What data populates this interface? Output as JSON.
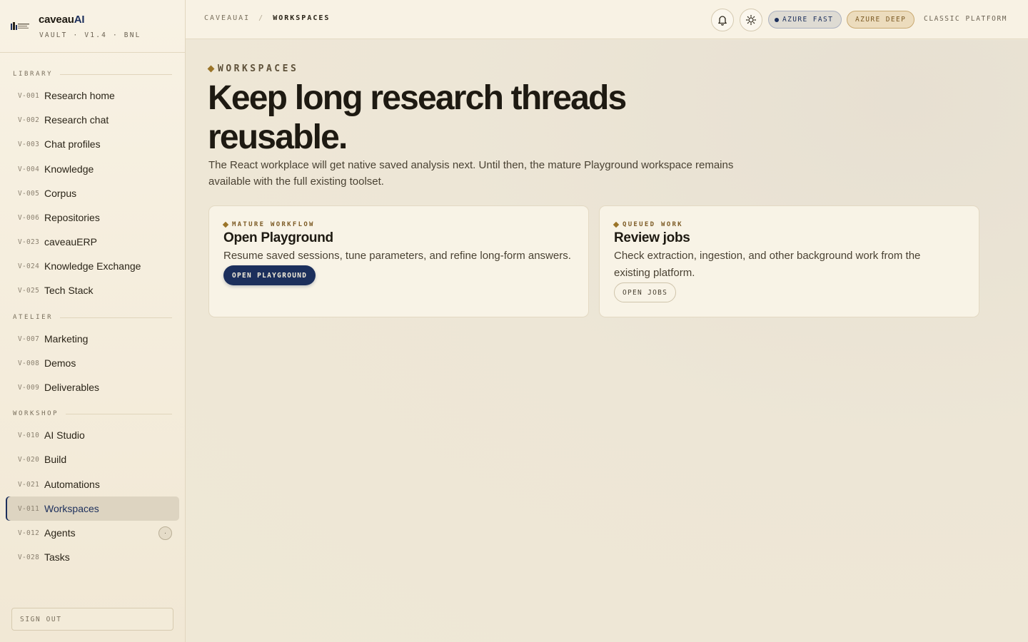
{
  "brand": {
    "name_prefix": "caveau",
    "name_suffix": "AI",
    "subtitle": "VAULT · V1.4 · BNL"
  },
  "sidebar": {
    "sections": [
      {
        "title": "LIBRARY",
        "items": [
          {
            "code": "V-001",
            "label": "Research home"
          },
          {
            "code": "V-002",
            "label": "Research chat"
          },
          {
            "code": "V-003",
            "label": "Chat profiles"
          },
          {
            "code": "V-004",
            "label": "Knowledge"
          },
          {
            "code": "V-005",
            "label": "Corpus"
          },
          {
            "code": "V-006",
            "label": "Repositories"
          },
          {
            "code": "V-023",
            "label": "caveauERP"
          },
          {
            "code": "V-024",
            "label": "Knowledge Exchange"
          },
          {
            "code": "V-025",
            "label": "Tech Stack"
          }
        ]
      },
      {
        "title": "ATELIER",
        "items": [
          {
            "code": "V-007",
            "label": "Marketing"
          },
          {
            "code": "V-008",
            "label": "Demos"
          },
          {
            "code": "V-009",
            "label": "Deliverables"
          }
        ]
      },
      {
        "title": "WORKSHOP",
        "items": [
          {
            "code": "V-010",
            "label": "AI Studio"
          },
          {
            "code": "V-020",
            "label": "Build"
          },
          {
            "code": "V-021",
            "label": "Automations"
          },
          {
            "code": "V-011",
            "label": "Workspaces",
            "active": true
          },
          {
            "code": "V-012",
            "label": "Agents",
            "badge": "·"
          },
          {
            "code": "V-028",
            "label": "Tasks"
          }
        ]
      }
    ],
    "signout_label": "SIGN OUT"
  },
  "topbar": {
    "breadcrumb": [
      "CAVEAUAI",
      "/",
      "WORKSPACES"
    ],
    "notifications_icon": "bell-icon",
    "theme_icon": "sun-icon",
    "azure_fast": "AZURE FAST",
    "azure_deep": "AZURE DEEP",
    "classic": "CLASSIC PLATFORM"
  },
  "main": {
    "eyebrow": "WORKSPACES",
    "title": "Keep long research threads reusable.",
    "description": "The React workplace will get native saved analysis next. Until then, the mature Playground workspace remains available with the full existing toolset.",
    "cards": [
      {
        "kicker": "MATURE WORKFLOW",
        "title": "Open Playground",
        "description": "Resume saved sessions, tune parameters, and refine long-form answers.",
        "button": "OPEN PLAYGROUND"
      },
      {
        "kicker": "QUEUED WORK",
        "title": "Review jobs",
        "description": "Check extraction, ingestion, and other background work from the existing platform.",
        "button": "OPEN JOBS"
      }
    ]
  },
  "colors": {
    "accent_navy": "#1c2f5c",
    "accent_gold": "#9a7428",
    "background": "#efe8d8"
  }
}
